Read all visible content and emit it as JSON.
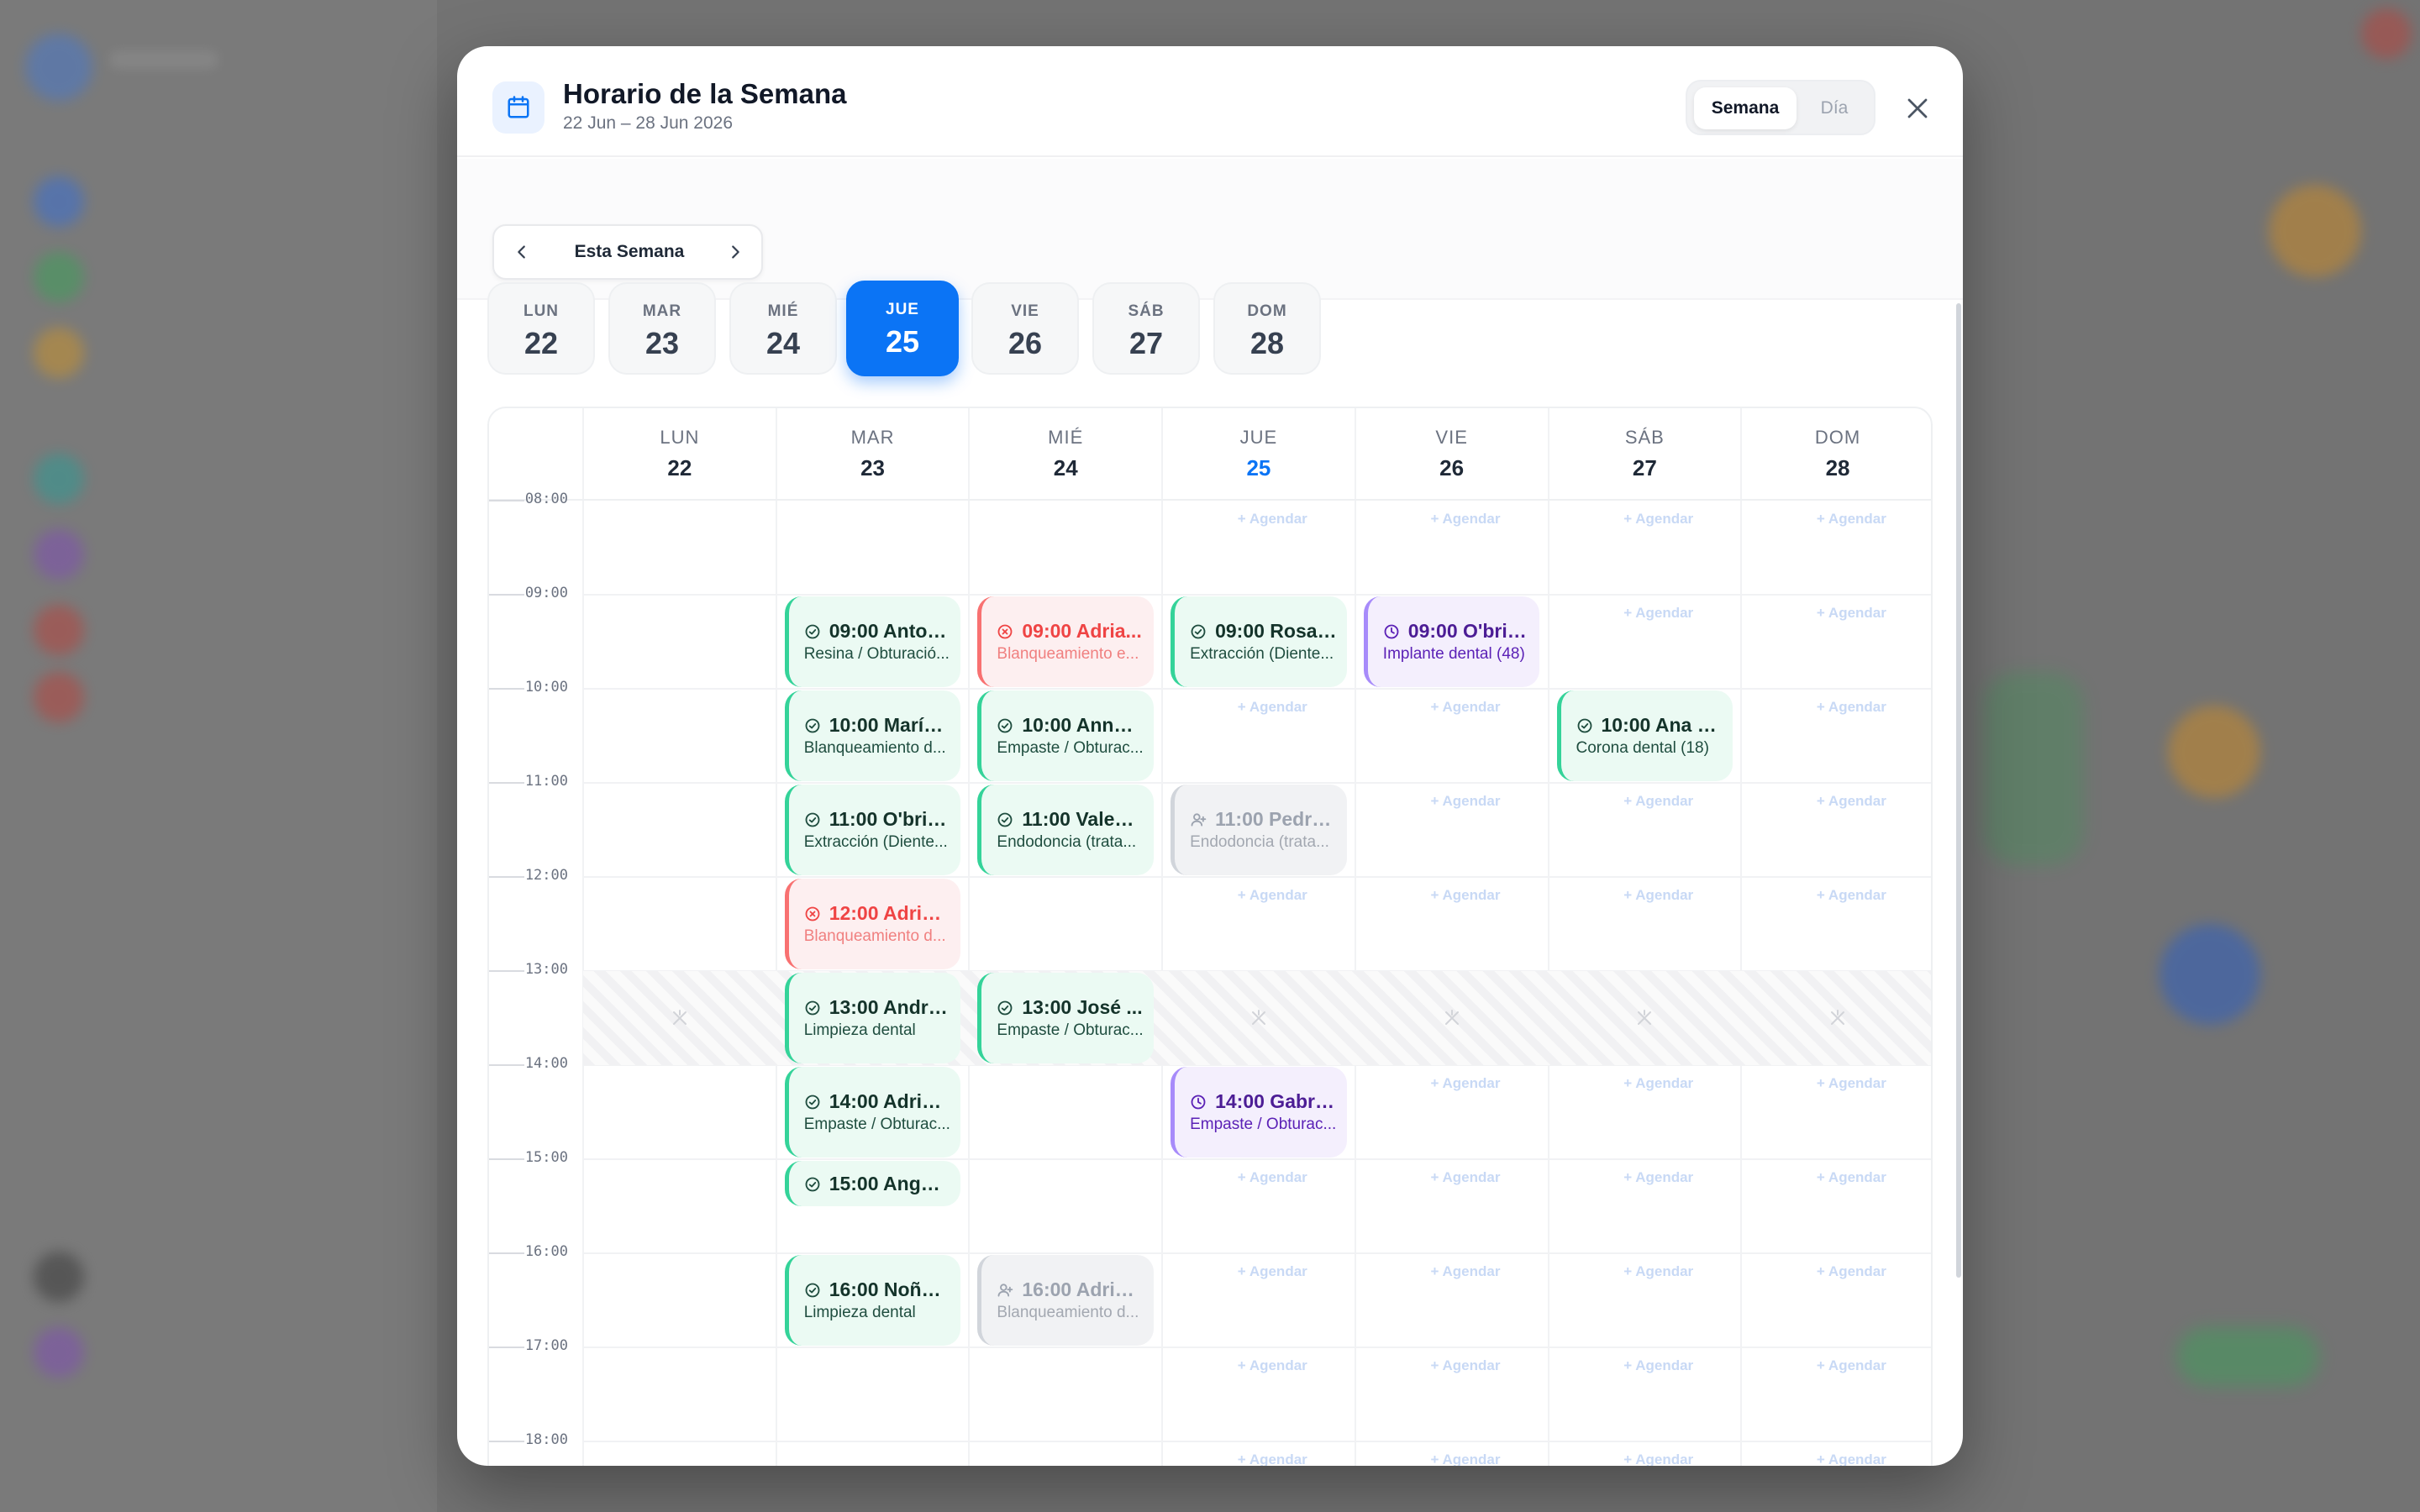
{
  "modal": {
    "title": "Horario de la Semana",
    "subtitle": "22 Jun – 28 Jun 2026",
    "view_week": "Semana",
    "view_day": "Día",
    "nav_label": "Esta Semana"
  },
  "day_pills": [
    {
      "name": "LUN",
      "num": "22"
    },
    {
      "name": "MAR",
      "num": "23"
    },
    {
      "name": "MIÉ",
      "num": "24"
    },
    {
      "name": "JUE",
      "num": "25",
      "active": true
    },
    {
      "name": "VIE",
      "num": "26"
    },
    {
      "name": "SÁB",
      "num": "27"
    },
    {
      "name": "DOM",
      "num": "28"
    }
  ],
  "columns": [
    {
      "name": "LUN",
      "num": "22"
    },
    {
      "name": "MAR",
      "num": "23"
    },
    {
      "name": "MIÉ",
      "num": "24"
    },
    {
      "name": "JUE",
      "num": "25",
      "today": true
    },
    {
      "name": "VIE",
      "num": "26"
    },
    {
      "name": "SÁB",
      "num": "27"
    },
    {
      "name": "DOM",
      "num": "28"
    }
  ],
  "hours": [
    "08:00",
    "09:00",
    "10:00",
    "11:00",
    "12:00",
    "13:00",
    "14:00",
    "15:00",
    "16:00",
    "17:00",
    "18:00"
  ],
  "lunch_hour": 13,
  "agendar_label": "+ Agendar",
  "agendar_slots": [
    {
      "day": 3,
      "hour": 8
    },
    {
      "day": 4,
      "hour": 8
    },
    {
      "day": 5,
      "hour": 8
    },
    {
      "day": 6,
      "hour": 8
    },
    {
      "day": 5,
      "hour": 9
    },
    {
      "day": 6,
      "hour": 9
    },
    {
      "day": 3,
      "hour": 10
    },
    {
      "day": 4,
      "hour": 10
    },
    {
      "day": 6,
      "hour": 10
    },
    {
      "day": 4,
      "hour": 11
    },
    {
      "day": 5,
      "hour": 11
    },
    {
      "day": 6,
      "hour": 11
    },
    {
      "day": 3,
      "hour": 12
    },
    {
      "day": 4,
      "hour": 12
    },
    {
      "day": 5,
      "hour": 12
    },
    {
      "day": 6,
      "hour": 12
    },
    {
      "day": 4,
      "hour": 14
    },
    {
      "day": 5,
      "hour": 14
    },
    {
      "day": 6,
      "hour": 14
    },
    {
      "day": 3,
      "hour": 15
    },
    {
      "day": 4,
      "hour": 15
    },
    {
      "day": 5,
      "hour": 15
    },
    {
      "day": 6,
      "hour": 15
    },
    {
      "day": 3,
      "hour": 16
    },
    {
      "day": 4,
      "hour": 16
    },
    {
      "day": 5,
      "hour": 16
    },
    {
      "day": 6,
      "hour": 16
    },
    {
      "day": 3,
      "hour": 17
    },
    {
      "day": 4,
      "hour": 17
    },
    {
      "day": 5,
      "hour": 17
    },
    {
      "day": 6,
      "hour": 17
    },
    {
      "day": 3,
      "hour": 18
    },
    {
      "day": 4,
      "hour": 18
    },
    {
      "day": 5,
      "hour": 18
    },
    {
      "day": 6,
      "hour": 18
    }
  ],
  "appointments": [
    {
      "day": 1,
      "hour": 9,
      "status": "confirmed",
      "color": "green",
      "title": "09:00 Anton...",
      "detail": "Resina / Obturació..."
    },
    {
      "day": 1,
      "hour": 10,
      "status": "confirmed",
      "color": "green",
      "title": "10:00 María ...",
      "detail": "Blanqueamiento d..."
    },
    {
      "day": 1,
      "hour": 11,
      "status": "confirmed",
      "color": "green",
      "title": "11:00 O'brie...",
      "detail": "Extracción (Diente..."
    },
    {
      "day": 1,
      "hour": 12,
      "status": "cancelled",
      "color": "red",
      "title": "12:00 Adrian...",
      "detail": "Blanqueamiento d..."
    },
    {
      "day": 1,
      "hour": 13,
      "status": "confirmed",
      "color": "green",
      "title": "13:00 André...",
      "detail": "Limpieza dental"
    },
    {
      "day": 1,
      "hour": 14,
      "status": "confirmed",
      "color": "green",
      "title": "14:00 Adrian...",
      "detail": "Empaste / Obturac..."
    },
    {
      "day": 1,
      "hour": 15,
      "status": "confirmed",
      "color": "green",
      "title": "15:00 Angel ...",
      "detail": "",
      "short": true
    },
    {
      "day": 1,
      "hour": 16,
      "status": "confirmed",
      "color": "green",
      "title": "16:00 Noño ...",
      "detail": "Limpieza dental"
    },
    {
      "day": 2,
      "hour": 9,
      "status": "cancelled",
      "color": "red",
      "title": "09:00 Adria...",
      "detail": "Blanqueamiento e..."
    },
    {
      "day": 2,
      "hour": 10,
      "status": "confirmed",
      "color": "green",
      "title": "10:00 Année...",
      "detail": "Empaste / Obturac..."
    },
    {
      "day": 2,
      "hour": 11,
      "status": "confirmed",
      "color": "green",
      "title": "11:00 Valenti...",
      "detail": "Endodoncia (trata..."
    },
    {
      "day": 2,
      "hour": 13,
      "status": "confirmed",
      "color": "green",
      "title": "13:00 José ...",
      "detail": "Empaste / Obturac..."
    },
    {
      "day": 2,
      "hour": 16,
      "status": "pending-user",
      "color": "gray",
      "title": "16:00 Adrian...",
      "detail": "Blanqueamiento d..."
    },
    {
      "day": 3,
      "hour": 9,
      "status": "confirmed",
      "color": "green",
      "title": "09:00 Rosa ...",
      "detail": "Extracción (Diente..."
    },
    {
      "day": 3,
      "hour": 11,
      "status": "pending-user",
      "color": "gray",
      "title": "11:00 Pedro ...",
      "detail": "Endodoncia (trata..."
    },
    {
      "day": 3,
      "hour": 14,
      "status": "scheduled",
      "color": "purple",
      "title": "14:00 Gabrie...",
      "detail": "Empaste / Obturac..."
    },
    {
      "day": 4,
      "hour": 9,
      "status": "scheduled",
      "color": "purple",
      "title": "09:00 O'brie...",
      "detail": "Implante dental (48)"
    },
    {
      "day": 5,
      "hour": 10,
      "status": "confirmed",
      "color": "green",
      "title": "10:00 Ana S...",
      "detail": "Corona dental (18)"
    }
  ],
  "colors": {
    "accent": "#0b74f5",
    "green": "#34d399",
    "red": "#f87171",
    "purple": "#a78bfa",
    "gray": "#d1d5db"
  }
}
